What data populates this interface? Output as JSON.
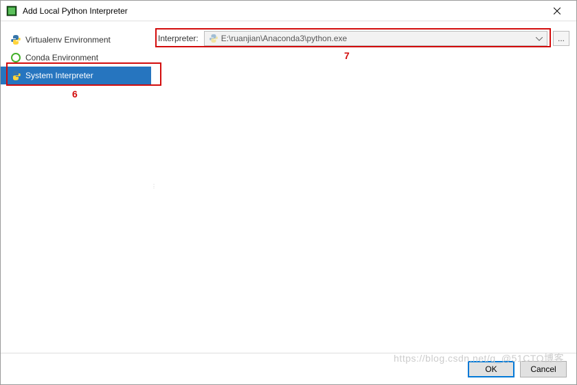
{
  "titlebar": {
    "title": "Add Local Python Interpreter"
  },
  "sidebar": {
    "items": [
      {
        "label": "Virtualenv Environment"
      },
      {
        "label": "Conda Environment"
      },
      {
        "label": "System Interpreter"
      }
    ]
  },
  "content": {
    "interpreter_label": "Interpreter:",
    "interpreter_path": "E:\\ruanjian\\Anaconda3\\python.exe",
    "browse_label": "..."
  },
  "footer": {
    "ok_label": "OK",
    "cancel_label": "Cancel"
  },
  "annotations": {
    "label6": "6",
    "label7": "7"
  },
  "watermark": "https://blog.csdn.net/q_@51CTO博客"
}
